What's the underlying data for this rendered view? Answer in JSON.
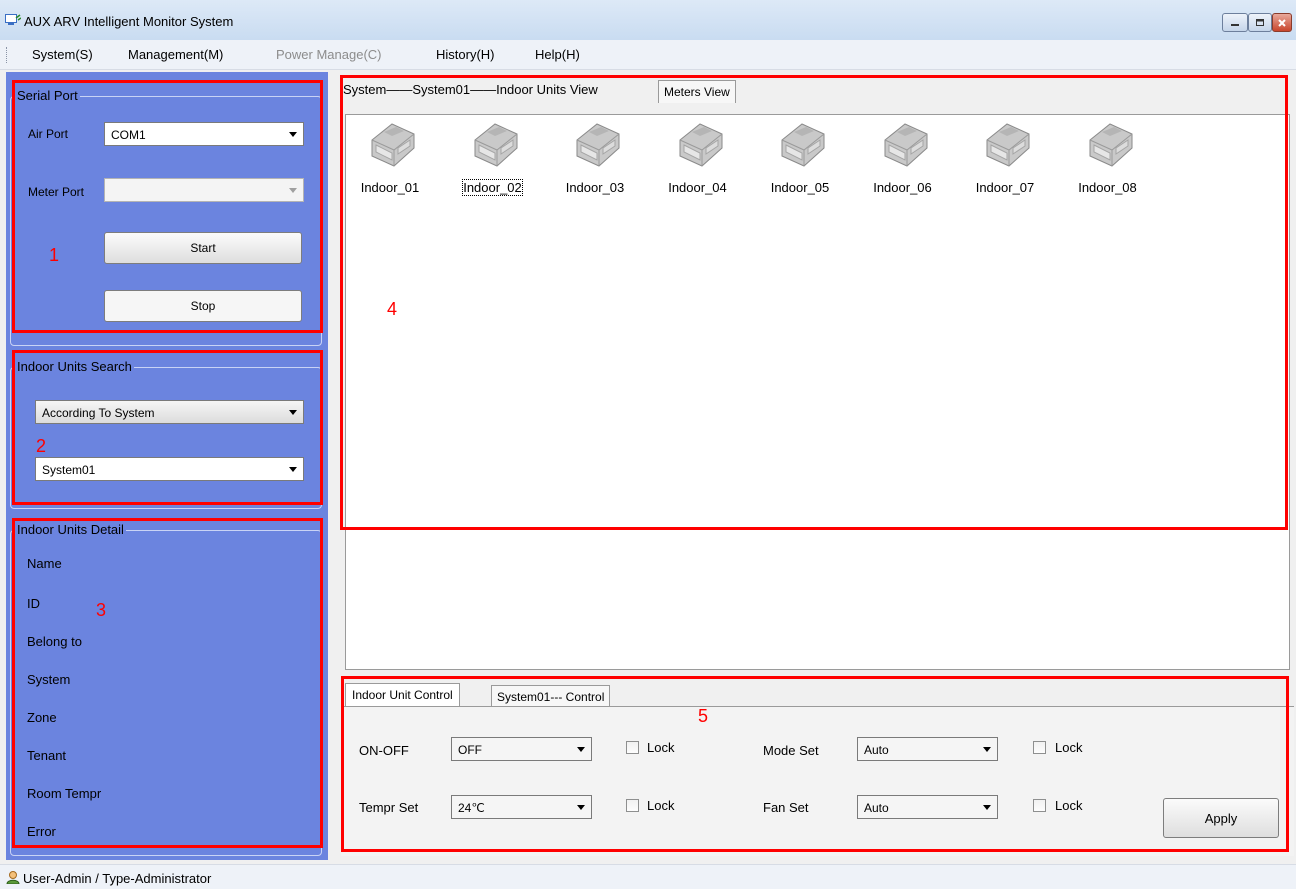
{
  "window": {
    "title": "AUX ARV Intelligent Monitor System",
    "controls": [
      "minimize",
      "maximize",
      "close"
    ]
  },
  "menu": {
    "items": [
      {
        "label": "System(S)",
        "enabled": true
      },
      {
        "label": "Management(M)",
        "enabled": true
      },
      {
        "label": "Power Manage(C)",
        "enabled": false
      },
      {
        "label": "History(H)",
        "enabled": true
      },
      {
        "label": "Help(H)",
        "enabled": true
      }
    ]
  },
  "serial_port": {
    "legend": "Serial Port",
    "air_port_label": "Air Port",
    "air_port_value": "COM1",
    "meter_port_label": "Meter Port",
    "meter_port_value": "",
    "start_label": "Start",
    "stop_label": "Stop"
  },
  "search": {
    "legend": "Indoor Units Search",
    "mode_value": "According To System",
    "system_value": "System01"
  },
  "detail": {
    "legend": "Indoor Units Detail",
    "fields": [
      "Name",
      "ID",
      "Belong to",
      "System",
      "Zone",
      "Tenant",
      "Room Tempr",
      "Error"
    ]
  },
  "view": {
    "breadcrumb": "System——System01——Indoor Units View",
    "meters_tab": "Meters View",
    "units": [
      "Indoor_01",
      "Indoor_02",
      "Indoor_03",
      "Indoor_04",
      "Indoor_05",
      "Indoor_06",
      "Indoor_07",
      "Indoor_08"
    ],
    "selected_unit": "Indoor_02"
  },
  "control": {
    "tab_active": "Indoor Unit Control",
    "tab_other": "System01--- Control",
    "onoff_label": "ON-OFF",
    "onoff_value": "OFF",
    "tempr_label": "Tempr Set",
    "tempr_value": "24℃",
    "mode_label": "Mode Set",
    "mode_value": "Auto",
    "fan_label": "Fan Set",
    "fan_value": "Auto",
    "lock_label": "Lock",
    "apply_label": "Apply"
  },
  "annotations": [
    "1",
    "2",
    "3",
    "4",
    "5"
  ],
  "status": {
    "text": "User-Admin / Type-Administrator"
  },
  "colors": {
    "left_panel": "#6b84df",
    "annotation": "#ff0000",
    "title_bar": "#dde9f7"
  }
}
